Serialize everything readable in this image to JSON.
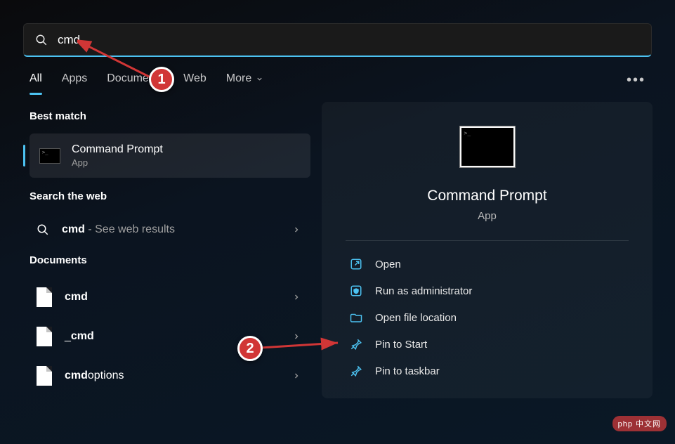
{
  "search": {
    "value": "cmd"
  },
  "tabs": {
    "all": "All",
    "apps": "Apps",
    "documents": "Documents",
    "web": "Web",
    "more": "More"
  },
  "sections": {
    "best_match": "Best match",
    "search_web": "Search the web",
    "documents": "Documents"
  },
  "best_match": {
    "title": "Command Prompt",
    "subtitle": "App"
  },
  "web_result": {
    "term": "cmd",
    "suffix": " - See web results"
  },
  "doc_results": [
    {
      "bold": "cmd",
      "rest": ""
    },
    {
      "bold": "",
      "prefix": "_",
      "rest": "cmd",
      "bold_rest": true
    },
    {
      "bold": "cmd",
      "rest": "options"
    }
  ],
  "preview": {
    "title": "Command Prompt",
    "subtitle": "App",
    "actions": {
      "open": "Open",
      "run_admin": "Run as administrator",
      "open_loc": "Open file location",
      "pin_start": "Pin to Start",
      "pin_taskbar": "Pin to taskbar"
    }
  },
  "annotations": {
    "label1": "1",
    "label2": "2"
  },
  "watermark": "php 中文网"
}
